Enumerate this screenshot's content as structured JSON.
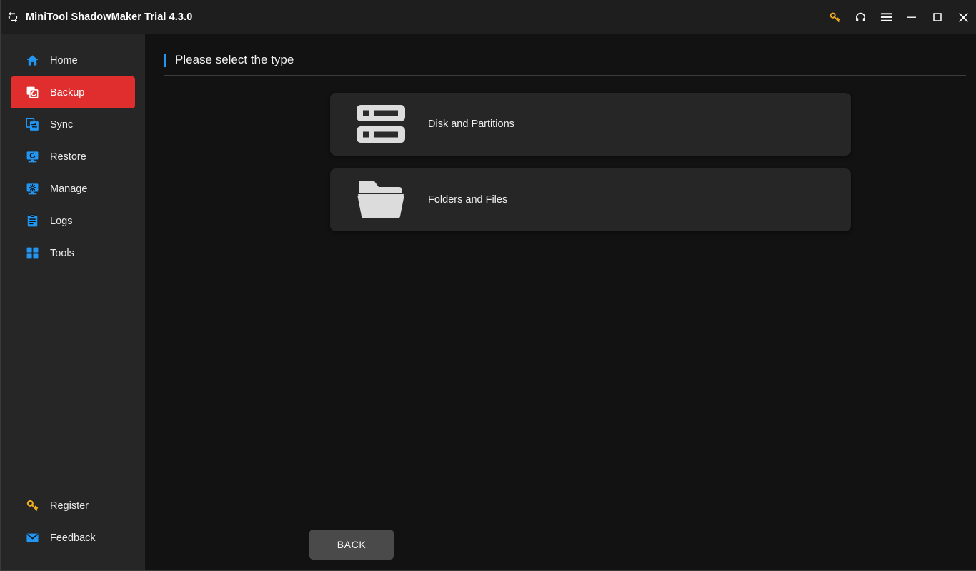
{
  "window": {
    "title": "MiniTool ShadowMaker Trial 4.3.0",
    "logo_icon": "sync-arrows-icon",
    "controls": [
      {
        "name": "key-icon",
        "label": "Register",
        "color": "#f2b01e"
      },
      {
        "name": "headset-icon",
        "label": "Support",
        "color": "#ffffff"
      },
      {
        "name": "hamburger-menu-icon",
        "label": "Menu",
        "color": "#ffffff"
      },
      {
        "name": "minimize-icon",
        "label": "Minimize",
        "color": "#ffffff"
      },
      {
        "name": "maximize-icon",
        "label": "Maximize",
        "color": "#ffffff"
      },
      {
        "name": "close-icon",
        "label": "Close",
        "color": "#ffffff"
      }
    ]
  },
  "sidebar": {
    "background": "#262626",
    "active_color": "#e02d2d",
    "icon_color": "#2196f3",
    "items": [
      {
        "label": "Home",
        "icon": "home-icon",
        "active": false
      },
      {
        "label": "Backup",
        "icon": "backup-icon",
        "active": true
      },
      {
        "label": "Sync",
        "icon": "sync-icon",
        "active": false
      },
      {
        "label": "Restore",
        "icon": "restore-icon",
        "active": false
      },
      {
        "label": "Manage",
        "icon": "manage-icon",
        "active": false
      },
      {
        "label": "Logs",
        "icon": "logs-icon",
        "active": false
      },
      {
        "label": "Tools",
        "icon": "tools-icon",
        "active": false
      }
    ],
    "bottom_items": [
      {
        "label": "Register",
        "icon": "key-icon",
        "color": "#f2b01e"
      },
      {
        "label": "Feedback",
        "icon": "envelope-icon",
        "color": "#2196f3"
      }
    ]
  },
  "main": {
    "heading": "Please select the type",
    "accent_color": "#2196f3",
    "cards": [
      {
        "label": "Disk and Partitions",
        "icon": "disk-partitions-icon"
      },
      {
        "label": "Folders and Files",
        "icon": "folder-icon"
      }
    ],
    "back_label": "BACK"
  }
}
